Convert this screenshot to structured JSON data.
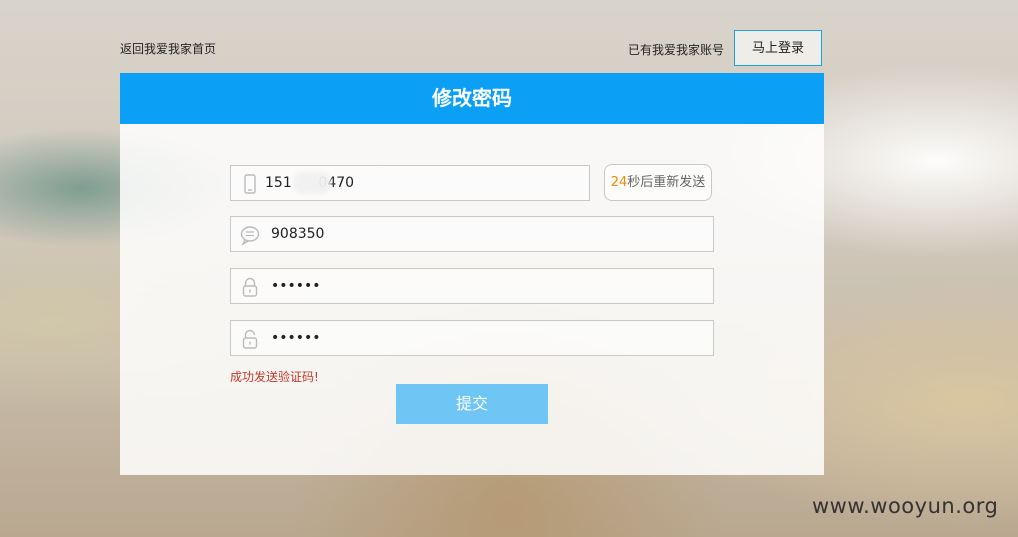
{
  "topbar": {
    "back_home_link": "返回我爱我家首页",
    "have_account_text": "已有我爱我家账号",
    "login_button": "马上登录"
  },
  "form": {
    "title": "修改密码",
    "phone_value": "151      0470",
    "resend_count": "24",
    "resend_suffix": "秒后重新发送",
    "sms_code_value": "908350",
    "password_value": "••••••",
    "confirm_password_value": "••••••",
    "status_message": "成功发送验证码!",
    "submit_button": "提交"
  },
  "watermark": "www.wooyun.org",
  "colors": {
    "header_bg": "#0ba0f6",
    "submit_bg": "#6fc5f4",
    "login_border": "#1aa3e8",
    "countdown": "#f08a00",
    "status_text": "#c0392b"
  },
  "icons": {
    "phone_field": "phone-icon",
    "sms_field": "chat-bubble-icon",
    "password_field": "lock-closed-icon",
    "confirm_field": "lock-open-icon"
  }
}
